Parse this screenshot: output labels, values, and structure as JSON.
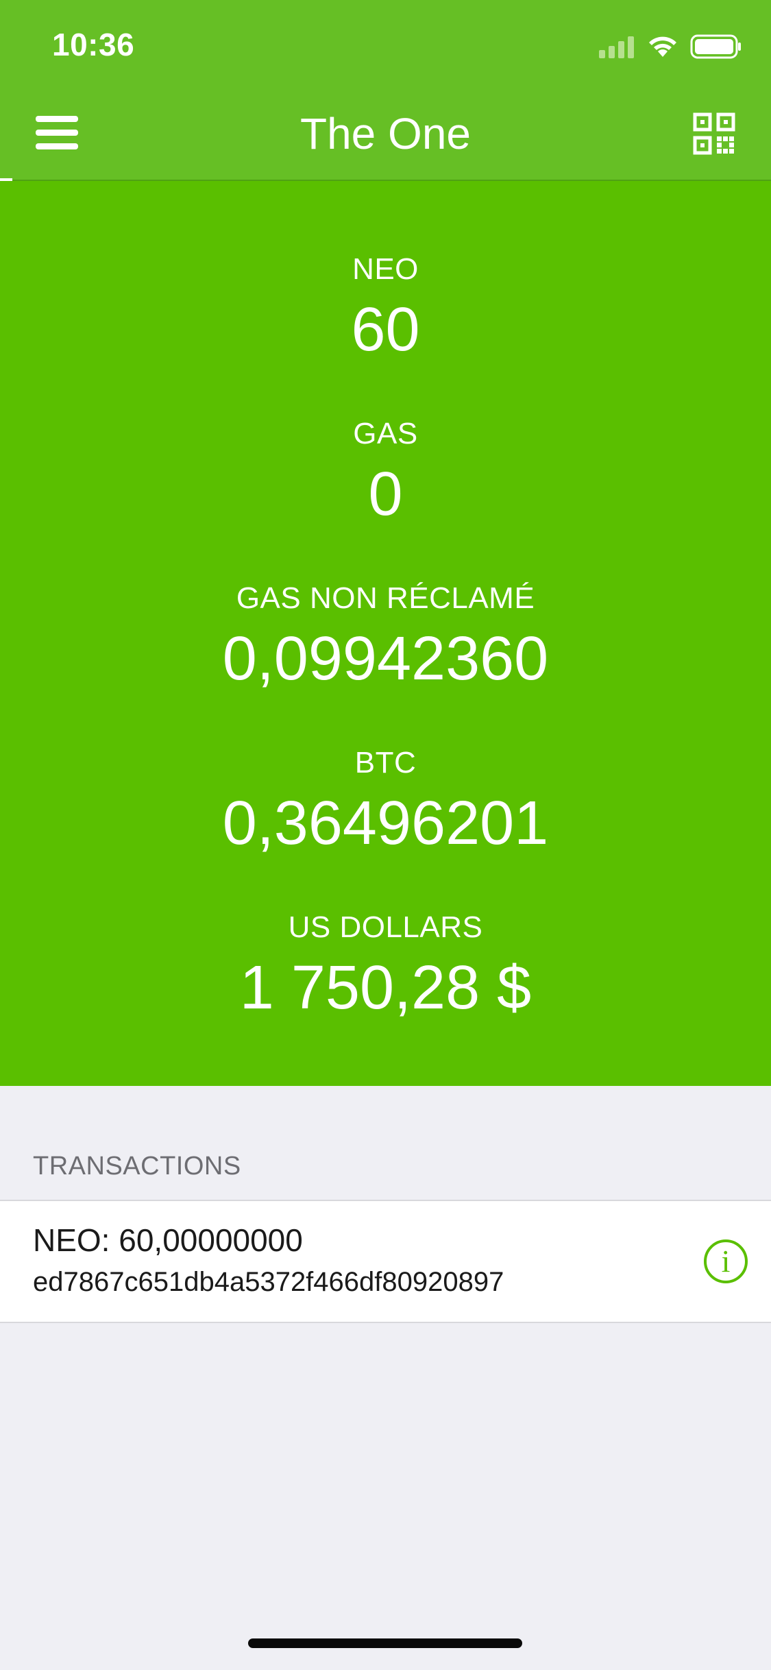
{
  "status_bar": {
    "time": "10:36",
    "icons": [
      "signal-icon",
      "wifi-icon",
      "battery-icon"
    ]
  },
  "nav": {
    "title": "The One",
    "left_icon": "menu-icon",
    "right_icon": "qr-code-icon"
  },
  "balances": [
    {
      "label": "NEO",
      "value": "60"
    },
    {
      "label": "GAS",
      "value": "0"
    },
    {
      "label": "GAS NON RÉCLAMÉ",
      "value": "0,09942360"
    },
    {
      "label": "BTC",
      "value": "0,36496201"
    },
    {
      "label": "US DOLLARS",
      "value": "1 750,28 $"
    }
  ],
  "transactions": {
    "header": "TRANSACTIONS",
    "items": [
      {
        "amount": "NEO: 60,00000000",
        "hash": "ed7867c651db4a5372f466df80920897",
        "action_icon": "info-icon",
        "action_glyph": "i"
      }
    ]
  },
  "colors": {
    "nav_bar": "#66bf25",
    "balance_panel": "#5abf00",
    "background": "#efeff4",
    "accent": "#5abf00"
  }
}
